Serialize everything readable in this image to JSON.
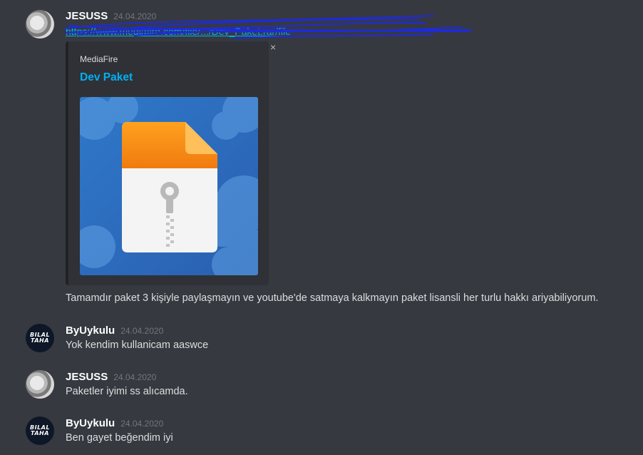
{
  "messages": [
    {
      "username": "JESUSS",
      "timestamp": "24.04.2020",
      "link": "https://www.mediafire.com/file/.../Dev_Paket.rar/file",
      "embed": {
        "provider": "MediaFire",
        "title": "Dev Paket",
        "close": "×"
      },
      "text": "Tamamdır paket 3 kişiyle paylaşmayın ve youtube'de satmaya kalkmayın paket lisansli her turlu hakkı ariyabiliyorum."
    },
    {
      "username": "ByUykulu",
      "timestamp": "24.04.2020",
      "avatar_text": [
        "BILAL",
        "TAHA"
      ],
      "text": "Yok kendim kullanicam aaswce"
    },
    {
      "username": "JESUSS",
      "timestamp": "24.04.2020",
      "text": "Paketler iyimi ss alıcamda."
    },
    {
      "username": "ByUykulu",
      "timestamp": "24.04.2020",
      "avatar_text": [
        "BILAL",
        "TAHA"
      ],
      "text": "Ben gayet beğendim iyi"
    }
  ],
  "icons": {
    "close": "close-icon",
    "file": "zip-file-icon"
  },
  "colors": {
    "background": "#36393f",
    "embed_bg": "#2f3136",
    "link": "#00b0f4",
    "username": "#ffffff",
    "timestamp": "#72767d",
    "scribble": "#1f2bd6"
  }
}
